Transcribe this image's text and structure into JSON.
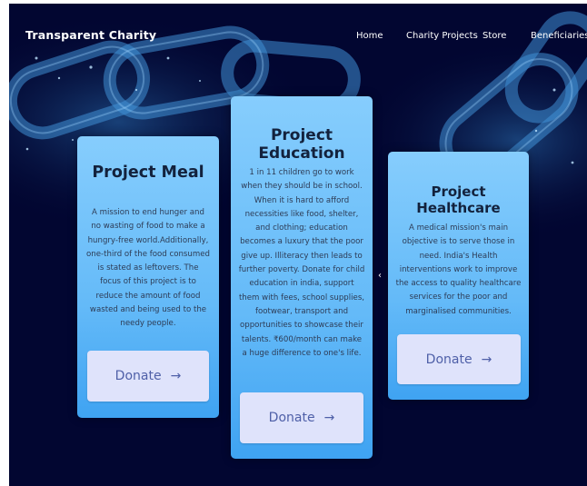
{
  "brand": "Transparent Charity",
  "nav": {
    "home": "Home",
    "projects": "Charity Projects",
    "store": "Store",
    "beneficiaries": "Beneficiaries"
  },
  "cards": {
    "meal": {
      "title": "Project Meal",
      "body": "A mission to end hunger and no wasting of food to make a hungry-free world.Additionally, one-third of the food consumed is stated as leftovers. The focus of this project is to reduce the amount of food wasted and being used to the needy people.",
      "donate": "Donate"
    },
    "education": {
      "title": "Project Education",
      "body": "1 in 11 children go to work when they should be in school. When it is hard to afford necessities like food, shelter, and clothing; education becomes a luxury that the poor give up. Illiteracy then leads to further poverty. Donate for child education in india, support them with fees, school supplies, footwear, transport and opportunities to showcase their talents. ₹600/month can make a huge difference to one's life.",
      "donate": "Donate"
    },
    "healthcare": {
      "title": "Project Healthcare",
      "body": "A medical mission's main objective is to serve those in need. India's Health interventions work to improve the access to quality healthcare services for the poor and marginalised communities.",
      "donate": "Donate"
    }
  },
  "arrow_glyph": "→",
  "carousel_prev_glyph": "‹",
  "colors": {
    "background": "#020631",
    "card": "#75c4fb",
    "donate_button": "#dfe3fb",
    "donate_text": "#4f60a8"
  }
}
